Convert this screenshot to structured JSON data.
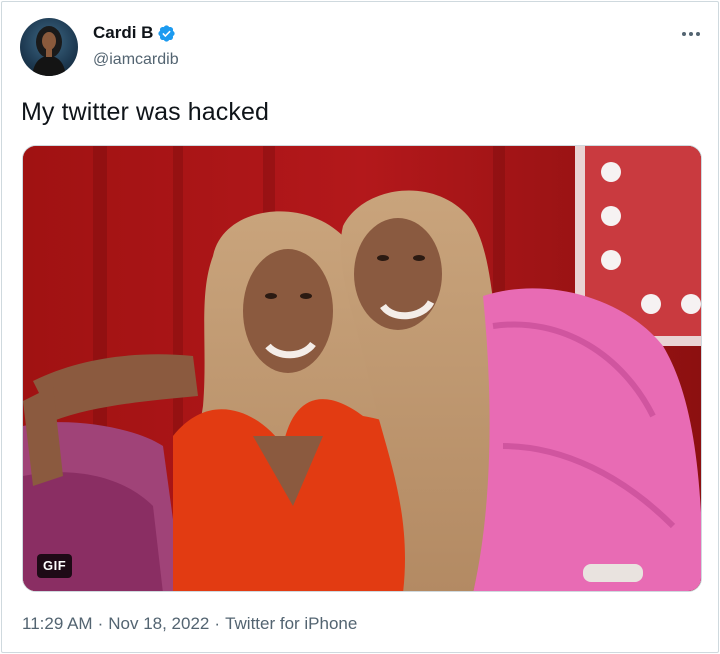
{
  "author": {
    "display_name": "Cardi B",
    "handle": "@iamcardib",
    "verified": true,
    "avatar_icon": "profile-photo"
  },
  "tweet": {
    "text": "My twitter was hacked",
    "media_badge": "GIF",
    "time": "11:29 AM",
    "date": "Nov 18, 2022",
    "separator": "·",
    "source": "Twitter for iPhone"
  },
  "icons": {
    "more": "more-horizontal-icon",
    "verified": "verified-badge-icon"
  },
  "colors": {
    "verified_blue": "#1d9bf0",
    "text_primary": "#0f1419",
    "text_secondary": "#536471",
    "border": "#cfd9de"
  }
}
